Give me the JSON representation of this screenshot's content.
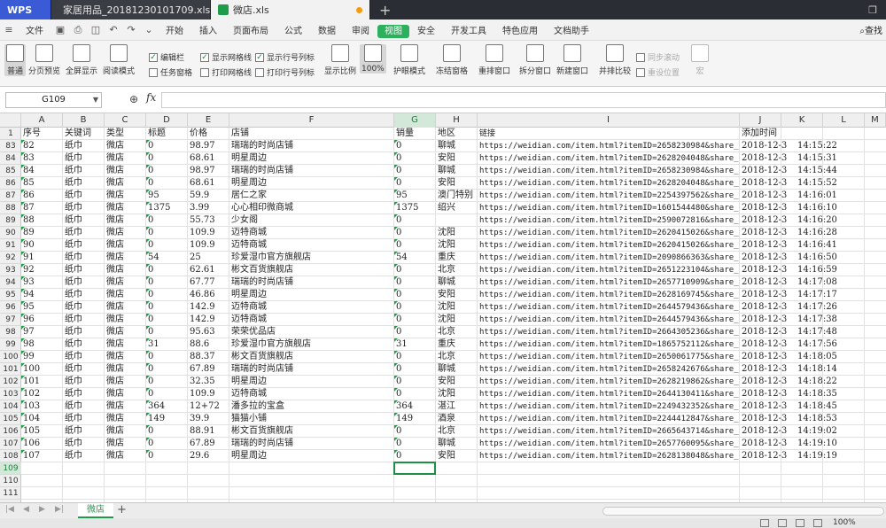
{
  "titlebar": {
    "app": "WPS",
    "tabs": [
      {
        "label": "家居用品_20181230101709.xls",
        "active": false
      },
      {
        "label": "微店.xls",
        "active": true
      }
    ]
  },
  "menu": {
    "file": "文件",
    "items": [
      "开始",
      "插入",
      "页面布局",
      "公式",
      "数据",
      "审阅",
      "视图",
      "安全",
      "开发工具",
      "特色应用",
      "文档助手"
    ],
    "active": "视图",
    "search": "查找"
  },
  "ribbon": {
    "buttons": [
      "普通",
      "分页预览",
      "全屏显示",
      "阅读模式",
      "显示比例",
      "100%",
      "护眼模式",
      "冻结窗格",
      "重排窗口",
      "拆分窗口",
      "新建窗口",
      "并排比较",
      "同步滚动",
      "重设位置",
      "宏"
    ],
    "checks": [
      {
        "label": "编辑栏",
        "checked": true
      },
      {
        "label": "任务窗格",
        "checked": false
      },
      {
        "label": "显示网格线",
        "checked": true
      },
      {
        "label": "打印网格线",
        "checked": false
      },
      {
        "label": "显示行号列标",
        "checked": true
      },
      {
        "label": "打印行号列标",
        "checked": false
      }
    ]
  },
  "formula": {
    "namebox": "G109",
    "fx": "fx",
    "value": ""
  },
  "columns": [
    "A",
    "B",
    "C",
    "D",
    "E",
    "F",
    "G",
    "H",
    "I",
    "J",
    "K",
    "L",
    "M"
  ],
  "header_row": {
    "num": "1",
    "cells": [
      "序号",
      "关键词",
      "类型",
      "标题",
      "价格",
      "店铺",
      "销量",
      "地区",
      "链接",
      "添加时间"
    ]
  },
  "rows": [
    [
      "83",
      "82",
      "纸巾",
      "微店",
      "0",
      "98.97",
      "瑞瑞的时尚店铺",
      "0",
      "聊城",
      "https://weidian.com/item.html?itemID=2658230984&share_re",
      "2018-12-30",
      "14:15:22"
    ],
    [
      "84",
      "83",
      "纸巾",
      "微店",
      "0",
      "68.61",
      "明星周边",
      "0",
      "安阳",
      "https://weidian.com/item.html?itemID=2628204048&share_re",
      "2018-12-30",
      "14:15:31"
    ],
    [
      "85",
      "84",
      "纸巾",
      "微店",
      "0",
      "98.97",
      "瑞瑞的时尚店铺",
      "0",
      "聊城",
      "https://weidian.com/item.html?itemID=2658230984&share_re",
      "2018-12-30",
      "14:15:44"
    ],
    [
      "86",
      "85",
      "纸巾",
      "微店",
      "0",
      "68.61",
      "明星周边",
      "0",
      "安阳",
      "https://weidian.com/item.html?itemID=2628204048&share_re",
      "2018-12-30",
      "14:15:52"
    ],
    [
      "87",
      "86",
      "纸巾",
      "微店",
      "95",
      "59.9",
      "居仁之家",
      "95",
      "澳门特别",
      "https://weidian.com/item.html?itemID=2254397562&share_re",
      "2018-12-30",
      "14:16:01"
    ],
    [
      "88",
      "87",
      "纸巾",
      "微店",
      "1375",
      "3.99",
      "心心相印微商城",
      "1375",
      "绍兴",
      "https://weidian.com/item.html?itemID=1601544480&share_re",
      "2018-12-30",
      "14:16:10"
    ],
    [
      "89",
      "88",
      "纸巾",
      "微店",
      "0",
      "55.73",
      "少女阁",
      "0",
      "",
      "https://weidian.com/item.html?itemID=2590072816&share_re",
      "2018-12-30",
      "14:16:20"
    ],
    [
      "90",
      "89",
      "纸巾",
      "微店",
      "0",
      "109.9",
      "迈特商城",
      "0",
      "沈阳",
      "https://weidian.com/item.html?itemID=2620415026&share_re",
      "2018-12-30",
      "14:16:28"
    ],
    [
      "91",
      "90",
      "纸巾",
      "微店",
      "0",
      "109.9",
      "迈特商城",
      "0",
      "沈阳",
      "https://weidian.com/item.html?itemID=2620415026&share_re",
      "2018-12-30",
      "14:16:41"
    ],
    [
      "92",
      "91",
      "纸巾",
      "微店",
      "54",
      "25",
      "珍爱湿巾官方旗舰店",
      "54",
      "重庆",
      "https://weidian.com/item.html?itemID=2090866363&share_re",
      "2018-12-30",
      "14:16:50"
    ],
    [
      "93",
      "92",
      "纸巾",
      "微店",
      "0",
      "62.61",
      "彬文百货旗舰店",
      "0",
      "北京",
      "https://weidian.com/item.html?itemID=2651223104&share_re",
      "2018-12-30",
      "14:16:59"
    ],
    [
      "94",
      "93",
      "纸巾",
      "微店",
      "0",
      "67.77",
      "瑞瑞的时尚店铺",
      "0",
      "聊城",
      "https://weidian.com/item.html?itemID=2657710909&share_re",
      "2018-12-30",
      "14:17:08"
    ],
    [
      "95",
      "94",
      "纸巾",
      "微店",
      "0",
      "46.86",
      "明星周边",
      "0",
      "安阳",
      "https://weidian.com/item.html?itemID=2628169745&share_re",
      "2018-12-30",
      "14:17:17"
    ],
    [
      "96",
      "95",
      "纸巾",
      "微店",
      "0",
      "142.9",
      "迈特商城",
      "0",
      "沈阳",
      "https://weidian.com/item.html?itemID=2644579436&share_re",
      "2018-12-30",
      "14:17:26"
    ],
    [
      "97",
      "96",
      "纸巾",
      "微店",
      "0",
      "142.9",
      "迈特商城",
      "0",
      "沈阳",
      "https://weidian.com/item.html?itemID=2644579436&share_re",
      "2018-12-30",
      "14:17:38"
    ],
    [
      "98",
      "97",
      "纸巾",
      "微店",
      "0",
      "95.63",
      "荣荣优品店",
      "0",
      "北京",
      "https://weidian.com/item.html?itemID=2664305236&share_re",
      "2018-12-30",
      "14:17:48"
    ],
    [
      "99",
      "98",
      "纸巾",
      "微店",
      "31",
      "88.6",
      "珍爱湿巾官方旗舰店",
      "31",
      "重庆",
      "https://weidian.com/item.html?itemID=1865752112&share_re",
      "2018-12-30",
      "14:17:56"
    ],
    [
      "100",
      "99",
      "纸巾",
      "微店",
      "0",
      "88.37",
      "彬文百货旗舰店",
      "0",
      "北京",
      "https://weidian.com/item.html?itemID=2650061775&share_re",
      "2018-12-30",
      "14:18:05"
    ],
    [
      "101",
      "100",
      "纸巾",
      "微店",
      "0",
      "67.89",
      "瑞瑞的时尚店铺",
      "0",
      "聊城",
      "https://weidian.com/item.html?itemID=2658242676&share_re",
      "2018-12-30",
      "14:18:14"
    ],
    [
      "102",
      "101",
      "纸巾",
      "微店",
      "0",
      "32.35",
      "明星周边",
      "0",
      "安阳",
      "https://weidian.com/item.html?itemID=2628219862&share_re",
      "2018-12-30",
      "14:18:22"
    ],
    [
      "103",
      "102",
      "纸巾",
      "微店",
      "0",
      "109.9",
      "迈特商城",
      "0",
      "沈阳",
      "https://weidian.com/item.html?itemID=2644130411&share_re",
      "2018-12-30",
      "14:18:35"
    ],
    [
      "104",
      "103",
      "纸巾",
      "微店",
      "364",
      "12+72",
      "潘多拉的宝盒",
      "364",
      "湛江",
      "https://weidian.com/item.html?itemID=2249432352&share_re",
      "2018-12-30",
      "14:18:45"
    ],
    [
      "105",
      "104",
      "纸巾",
      "微店",
      "149",
      "39.9",
      "猫猫小铺",
      "149",
      "酒泉",
      "https://weidian.com/item.html?itemID=2244412847&share_re",
      "2018-12-30",
      "14:18:53"
    ],
    [
      "106",
      "105",
      "纸巾",
      "微店",
      "0",
      "88.91",
      "彬文百货旗舰店",
      "0",
      "北京",
      "https://weidian.com/item.html?itemID=2665643714&share_re",
      "2018-12-30",
      "14:19:02"
    ],
    [
      "107",
      "106",
      "纸巾",
      "微店",
      "0",
      "67.89",
      "瑞瑞的时尚店铺",
      "0",
      "聊城",
      "https://weidian.com/item.html?itemID=2657760095&share_re",
      "2018-12-30",
      "14:19:10"
    ],
    [
      "108",
      "107",
      "纸巾",
      "微店",
      "0",
      "29.6",
      "明星周边",
      "0",
      "安阳",
      "https://weidian.com/item.html?itemID=2628138048&share_re",
      "2018-12-30",
      "14:19:19"
    ]
  ],
  "empty_rows": [
    "109",
    "110",
    "111"
  ],
  "sheet": {
    "name": "微店",
    "add": "+"
  },
  "status": {
    "zoom": "100%"
  },
  "colors": {
    "accent": "#2db05e",
    "selection": "#1f8f43"
  }
}
